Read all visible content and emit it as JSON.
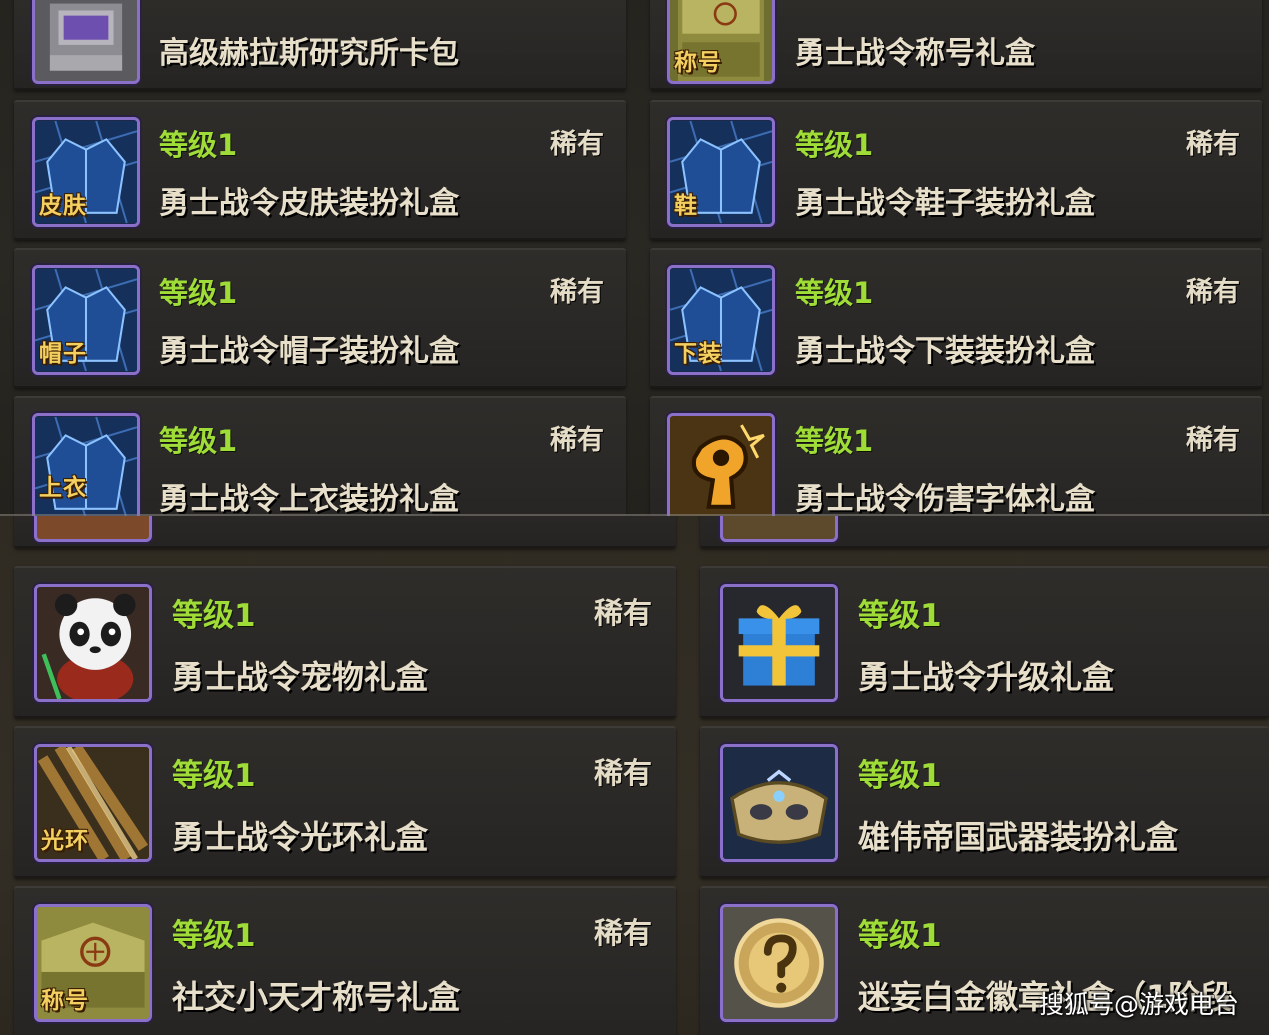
{
  "top_panel": {
    "items": [
      {
        "name": "高级赫拉斯研究所卡包",
        "icon": "card-pack-icon"
      },
      {
        "name": "勇士战令称号礼盒",
        "tag": "称号",
        "icon": "title-box-icon"
      },
      {
        "level": "等级1",
        "rarity": "稀有",
        "name": "勇士战令皮肤装扮礼盒",
        "tag": "皮肤",
        "icon": "costume-icon"
      },
      {
        "level": "等级1",
        "rarity": "稀有",
        "name": "勇士战令鞋子装扮礼盒",
        "tag": "鞋",
        "icon": "costume-icon"
      },
      {
        "level": "等级1",
        "rarity": "稀有",
        "name": "勇士战令帽子装扮礼盒",
        "tag": "帽子",
        "icon": "costume-icon"
      },
      {
        "level": "等级1",
        "rarity": "稀有",
        "name": "勇士战令下装装扮礼盒",
        "tag": "下装",
        "icon": "costume-icon"
      },
      {
        "level": "等级1",
        "rarity": "稀有",
        "name": "勇士战令上衣装扮礼盒",
        "tag": "上衣",
        "icon": "costume-icon"
      },
      {
        "level": "等级1",
        "rarity": "稀有",
        "name": "勇士战令伤害字体礼盒",
        "icon": "damage-font-icon"
      }
    ]
  },
  "bottom_panel": {
    "items": [
      {
        "level": "等级1",
        "rarity": "稀有",
        "name": "勇士战令宠物礼盒",
        "icon": "panda-pet-icon"
      },
      {
        "level": "等级1",
        "name": "勇士战令升级礼盒",
        "icon": "gift-box-icon"
      },
      {
        "level": "等级1",
        "rarity": "稀有",
        "name": "勇士战令光环礼盒",
        "tag": "光环",
        "icon": "aura-icon"
      },
      {
        "level": "等级1",
        "name": "雄伟帝国武器装扮礼盒",
        "icon": "weapon-chest-icon"
      },
      {
        "level": "等级1",
        "rarity": "稀有",
        "name": "社交小天才称号礼盒",
        "tag": "称号",
        "icon": "title-box-icon"
      },
      {
        "level": "等级1",
        "name": "迷妄白金徽章礼盒（1阶段",
        "icon": "question-mark-icon"
      }
    ]
  },
  "watermark": "搜狐号@游戏电台",
  "colors": {
    "level": "#9fdc37",
    "rarity": "#e4dcc6",
    "icon_border": "#8b70c9",
    "tag": "#f3d060"
  }
}
